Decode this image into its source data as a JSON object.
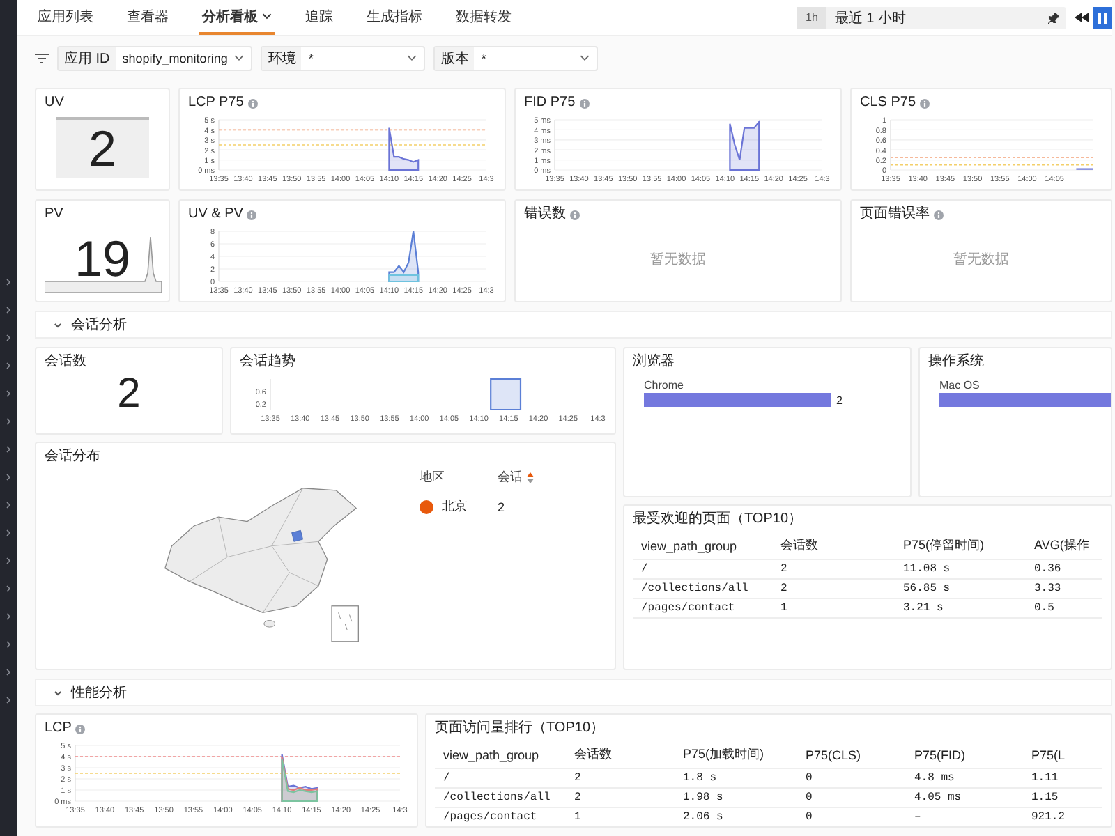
{
  "nav": {
    "tabs": [
      {
        "label": "应用列表",
        "selected": false,
        "dropdown": false
      },
      {
        "label": "查看器",
        "selected": false,
        "dropdown": false
      },
      {
        "label": "分析看板",
        "selected": true,
        "dropdown": true
      },
      {
        "label": "追踪",
        "selected": false,
        "dropdown": false
      },
      {
        "label": "生成指标",
        "selected": false,
        "dropdown": false
      },
      {
        "label": "数据转发",
        "selected": false,
        "dropdown": false
      }
    ],
    "time_range": {
      "badge": "1h",
      "label": "最近 1 小时"
    }
  },
  "filters": [
    {
      "label": "应用 ID",
      "value": "shopify_monitoring"
    },
    {
      "label": "环境",
      "value": "*"
    },
    {
      "label": "版本",
      "value": "*"
    }
  ],
  "overview_cards": [
    {
      "kind": "stat",
      "title": "UV",
      "help": false,
      "value": "2"
    },
    {
      "kind": "chart",
      "title": "LCP P75",
      "help": true,
      "chart_data": {
        "type": "area",
        "categories": [
          "13:35",
          null,
          null,
          null,
          null,
          "13:40",
          null,
          null,
          null,
          null,
          "13:45",
          null,
          null,
          null,
          null,
          "13:50",
          null,
          null,
          null,
          null,
          "13:55",
          null,
          null,
          null,
          null,
          "14:00",
          null,
          null,
          null,
          null,
          "14:05",
          null,
          null,
          null,
          null,
          "14:10",
          null,
          null,
          null,
          null,
          "14:15",
          null,
          null,
          null,
          null,
          "14:20",
          null,
          null,
          null,
          null,
          "14:25",
          null,
          null,
          null,
          null,
          "14:3"
        ],
        "ylim": [
          0,
          5
        ],
        "yticks": [
          {
            "value": 0,
            "label": "0 ms"
          },
          {
            "value": 1,
            "label": "1 s"
          },
          {
            "value": 2,
            "label": "2 s"
          },
          {
            "value": 3,
            "label": "3 s"
          },
          {
            "value": 4,
            "label": "4 s"
          },
          {
            "value": 5,
            "label": "5 s"
          }
        ],
        "grid": true,
        "ref_lines": [
          {
            "axis": "y",
            "value": 4,
            "color": "#f4a27a"
          },
          {
            "axis": "y",
            "value": 2.5,
            "color": "#f3cf6a"
          }
        ],
        "series": [
          {
            "color": "#6b74d6",
            "values": [
              null,
              null,
              null,
              null,
              null,
              null,
              null,
              null,
              null,
              null,
              null,
              null,
              null,
              null,
              null,
              null,
              null,
              null,
              null,
              null,
              null,
              null,
              null,
              null,
              null,
              null,
              null,
              null,
              null,
              null,
              null,
              null,
              null,
              null,
              null,
              4.2,
              1.3,
              1.3,
              1.1,
              1.0,
              0.8,
              1.0,
              null,
              null,
              null,
              null,
              null,
              null,
              null,
              null,
              null,
              null,
              null,
              null,
              null,
              null
            ]
          }
        ]
      }
    },
    {
      "kind": "chart",
      "title": "FID P75",
      "help": true,
      "chart_data": {
        "type": "area",
        "categories": [
          "13:35",
          null,
          null,
          null,
          null,
          "13:40",
          null,
          null,
          null,
          null,
          "13:45",
          null,
          null,
          null,
          null,
          "13:50",
          null,
          null,
          null,
          null,
          "13:55",
          null,
          null,
          null,
          null,
          "14:00",
          null,
          null,
          null,
          null,
          "14:05",
          null,
          null,
          null,
          null,
          "14:10",
          null,
          null,
          null,
          null,
          "14:15",
          null,
          null,
          null,
          null,
          "14:20",
          null,
          null,
          null,
          null,
          "14:25",
          null,
          null,
          null,
          null,
          "14:3"
        ],
        "grid": true,
        "ylim": [
          0,
          5
        ],
        "yticks": [
          {
            "value": 0,
            "label": "0 ms"
          },
          {
            "value": 1,
            "label": "1 ms"
          },
          {
            "value": 2,
            "label": "2 ms"
          },
          {
            "value": 3,
            "label": "3 ms"
          },
          {
            "value": 4,
            "label": "4 ms"
          },
          {
            "value": 5,
            "label": "5 ms"
          }
        ],
        "series": [
          {
            "color": "#6b74d6",
            "values": [
              null,
              null,
              null,
              null,
              null,
              null,
              null,
              null,
              null,
              null,
              null,
              null,
              null,
              null,
              null,
              null,
              null,
              null,
              null,
              null,
              null,
              null,
              null,
              null,
              null,
              null,
              null,
              null,
              null,
              null,
              null,
              null,
              null,
              null,
              null,
              null,
              4.6,
              2.5,
              1.0,
              4.2,
              4.2,
              4.2,
              4.8,
              null,
              null,
              null,
              null,
              null,
              null,
              null,
              null,
              null,
              null,
              null,
              null,
              null
            ]
          }
        ]
      }
    },
    {
      "kind": "chart",
      "title": "CLS P75",
      "help": true,
      "chart_data": {
        "type": "line",
        "categories": [
          "13:35",
          null,
          null,
          null,
          null,
          "13:40",
          null,
          null,
          null,
          null,
          "13:45",
          null,
          null,
          null,
          null,
          "13:50",
          null,
          null,
          null,
          null,
          "13:55",
          null,
          null,
          null,
          null,
          "14:00",
          null,
          null,
          null,
          null,
          "14:05",
          null,
          null,
          null,
          null,
          null,
          null,
          null
        ],
        "ylim": [
          0,
          1
        ],
        "yticks": [
          0,
          0.2,
          0.4,
          0.6,
          0.8,
          1
        ],
        "grid": true,
        "ref_lines": [
          {
            "axis": "y",
            "value": 0.25,
            "color": "#f4a27a"
          },
          {
            "axis": "y",
            "value": 0.1,
            "color": "#f3cf6a"
          }
        ],
        "series": [
          {
            "color": "#6b74d6",
            "values": [
              null,
              null,
              null,
              null,
              null,
              null,
              null,
              null,
              null,
              null,
              null,
              null,
              null,
              null,
              null,
              null,
              null,
              null,
              null,
              null,
              null,
              null,
              null,
              null,
              null,
              null,
              null,
              null,
              null,
              null,
              null,
              null,
              null,
              null,
              0.02,
              0.02,
              0.02,
              0.02
            ]
          }
        ]
      }
    },
    {
      "kind": "sparkline_stat",
      "title": "PV",
      "help": false,
      "value": "19"
    },
    {
      "kind": "chart",
      "title": "UV & PV",
      "help": true,
      "chart_data": {
        "type": "area",
        "categories": [
          "13:35",
          null,
          null,
          null,
          null,
          "13:40",
          null,
          null,
          null,
          null,
          "13:45",
          null,
          null,
          null,
          null,
          "13:50",
          null,
          null,
          null,
          null,
          "13:55",
          null,
          null,
          null,
          null,
          "14:00",
          null,
          null,
          null,
          null,
          "14:05",
          null,
          null,
          null,
          null,
          "14:10",
          null,
          null,
          null,
          null,
          "14:15",
          null,
          null,
          null,
          null,
          "14:20",
          null,
          null,
          null,
          null,
          "14:25",
          null,
          null,
          null,
          null,
          "14:3"
        ],
        "grid": true,
        "ylim": [
          0,
          8
        ],
        "yticks": [
          0,
          2,
          4,
          6,
          8
        ],
        "series": [
          {
            "color": "#5b7fd6",
            "values": [
              null,
              null,
              null,
              null,
              null,
              null,
              null,
              null,
              null,
              null,
              null,
              null,
              null,
              null,
              null,
              null,
              null,
              null,
              null,
              null,
              null,
              null,
              null,
              null,
              null,
              null,
              null,
              null,
              null,
              null,
              null,
              null,
              null,
              null,
              null,
              1.5,
              1.5,
              2.5,
              1.5,
              3,
              8,
              1.5,
              null,
              null,
              null,
              null,
              null,
              null,
              null,
              null,
              null,
              null,
              null,
              null,
              null,
              null
            ]
          },
          {
            "color": "#6fc3df",
            "values": [
              null,
              null,
              null,
              null,
              null,
              null,
              null,
              null,
              null,
              null,
              null,
              null,
              null,
              null,
              null,
              null,
              null,
              null,
              null,
              null,
              null,
              null,
              null,
              null,
              null,
              null,
              null,
              null,
              null,
              null,
              null,
              null,
              null,
              null,
              null,
              1,
              1,
              1,
              1,
              1,
              1,
              1,
              null,
              null,
              null,
              null,
              null,
              null,
              null,
              null,
              null,
              null,
              null,
              null,
              null,
              null
            ]
          }
        ]
      }
    },
    {
      "kind": "empty",
      "title": "错误数",
      "help": true,
      "empty_text": "暂无数据"
    },
    {
      "kind": "empty",
      "title": "页面错误率",
      "help": true,
      "empty_text": "暂无数据"
    }
  ],
  "session_section": {
    "title": "会话分析",
    "expanded": true,
    "count_card": {
      "title": "会话数",
      "value": "2"
    },
    "trend_card": {
      "title": "会话趋势",
      "chart_data": {
        "type": "area",
        "categories": [
          "13:35",
          null,
          null,
          null,
          null,
          "13:40",
          null,
          null,
          null,
          null,
          "13:45",
          null,
          null,
          null,
          null,
          "13:50",
          null,
          null,
          null,
          null,
          "13:55",
          null,
          null,
          null,
          null,
          "14:00",
          null,
          null,
          null,
          null,
          "14:05",
          null,
          null,
          null,
          null,
          "14:10",
          null,
          null,
          null,
          null,
          "14:15",
          null,
          null,
          null,
          null,
          "14:20",
          null,
          null,
          null,
          null,
          "14:25",
          null,
          null,
          null,
          null,
          "14:3"
        ],
        "ylim": [
          0,
          1
        ],
        "yticks": [
          0.2,
          0.6
        ],
        "series": [
          {
            "color": "#5b7fd6",
            "values": [
              null,
              null,
              null,
              null,
              null,
              null,
              null,
              null,
              null,
              null,
              null,
              null,
              null,
              null,
              null,
              null,
              null,
              null,
              null,
              null,
              null,
              null,
              null,
              null,
              null,
              null,
              null,
              null,
              null,
              null,
              null,
              null,
              null,
              null,
              null,
              null,
              null,
              1,
              1,
              1,
              1,
              1,
              1,
              null,
              null,
              null,
              null,
              null,
              null,
              null,
              null,
              null,
              null,
              null,
              null,
              null
            ]
          }
        ]
      }
    },
    "browser_card": {
      "title": "浏览器",
      "chart_data": {
        "type": "bar",
        "orientation": "horizontal",
        "categories": [
          "Chrome"
        ],
        "data_labels": true,
        "series": [
          {
            "color": "#7478de",
            "values": [
              2
            ]
          }
        ]
      }
    },
    "os_card": {
      "title": "操作系统",
      "bar_label": "Mac OS"
    },
    "map_card": {
      "title": "会话分布",
      "columns": [
        "地区",
        "会话"
      ],
      "regions": [
        {
          "name": "北京",
          "sessions": "2",
          "color": "#e8590c"
        }
      ]
    },
    "top_pages": {
      "title": "最受欢迎的页面（TOP10）",
      "columns": [
        "view_path_group",
        "会话数",
        "P75(停留时间)",
        "AVG(操作"
      ],
      "rows": [
        [
          "/",
          "2",
          "11.08 s",
          "0.36"
        ],
        [
          "/collections/all",
          "2",
          "56.85 s",
          "3.33"
        ],
        [
          "/pages/contact",
          "1",
          "3.21 s",
          "0.5"
        ]
      ]
    }
  },
  "performance_section": {
    "title": "性能分析",
    "expanded": true,
    "lcp_card": {
      "title": "LCP",
      "help": true,
      "chart_data": {
        "type": "area",
        "categories": [
          "13:35",
          null,
          null,
          null,
          null,
          "13:40",
          null,
          null,
          null,
          null,
          "13:45",
          null,
          null,
          null,
          null,
          "13:50",
          null,
          null,
          null,
          null,
          "13:55",
          null,
          null,
          null,
          null,
          "14:00",
          null,
          null,
          null,
          null,
          "14:05",
          null,
          null,
          null,
          null,
          "14:10",
          null,
          null,
          null,
          null,
          "14:15",
          null,
          null,
          null,
          null,
          "14:20",
          null,
          null,
          null,
          null,
          "14:25",
          null,
          null,
          null,
          null,
          "14:3"
        ],
        "ylim": [
          0,
          5
        ],
        "yticks": [
          {
            "value": 0,
            "label": "0 ms"
          },
          {
            "value": 1,
            "label": "1 s"
          },
          {
            "value": 2,
            "label": "2 s"
          },
          {
            "value": 3,
            "label": "3 s"
          },
          {
            "value": 4,
            "label": "4 s"
          },
          {
            "value": 5,
            "label": "5 s"
          }
        ],
        "grid": true,
        "ref_lines": [
          {
            "axis": "y",
            "value": 4,
            "color": "#f08a8a"
          },
          {
            "axis": "y",
            "value": 2.5,
            "color": "#f3cf6a"
          }
        ],
        "series": [
          {
            "color": "#6b74d6",
            "values": [
              null,
              null,
              null,
              null,
              null,
              null,
              null,
              null,
              null,
              null,
              null,
              null,
              null,
              null,
              null,
              null,
              null,
              null,
              null,
              null,
              null,
              null,
              null,
              null,
              null,
              null,
              null,
              null,
              null,
              null,
              null,
              null,
              null,
              null,
              null,
              4.2,
              1.3,
              1.4,
              1.2,
              1.3,
              1.1,
              1.2,
              null,
              null,
              null,
              null,
              null,
              null,
              null,
              null,
              null,
              null,
              null,
              null,
              null,
              null
            ]
          },
          {
            "color": "#e07b7b",
            "values": [
              null,
              null,
              null,
              null,
              null,
              null,
              null,
              null,
              null,
              null,
              null,
              null,
              null,
              null,
              null,
              null,
              null,
              null,
              null,
              null,
              null,
              null,
              null,
              null,
              null,
              null,
              null,
              null,
              null,
              null,
              null,
              null,
              null,
              null,
              null,
              4.0,
              1.1,
              1.0,
              1.2,
              1.0,
              1.0,
              1.1,
              null,
              null,
              null,
              null,
              null,
              null,
              null,
              null,
              null,
              null,
              null,
              null,
              null,
              null
            ]
          },
          {
            "color": "#7cc4a0",
            "values": [
              null,
              null,
              null,
              null,
              null,
              null,
              null,
              null,
              null,
              null,
              null,
              null,
              null,
              null,
              null,
              null,
              null,
              null,
              null,
              null,
              null,
              null,
              null,
              null,
              null,
              null,
              null,
              null,
              null,
              null,
              null,
              null,
              null,
              null,
              null,
              3.8,
              0.9,
              0.8,
              1.0,
              0.9,
              0.8,
              0.9,
              null,
              null,
              null,
              null,
              null,
              null,
              null,
              null,
              null,
              null,
              null,
              null,
              null,
              null
            ]
          }
        ]
      }
    },
    "top_pages": {
      "title": "页面访问量排行（TOP10）",
      "columns": [
        "view_path_group",
        "会话数",
        "P75(加载时间)",
        "P75(CLS)",
        "P75(FID)",
        "P75(L"
      ],
      "rows": [
        [
          "/",
          "2",
          "1.8 s",
          "0",
          "4.8 ms",
          "1.11"
        ],
        [
          "/collections/all",
          "2",
          "1.98 s",
          "0",
          "4.05 ms",
          "1.15"
        ],
        [
          "/pages/contact",
          "1",
          "2.06 s",
          "0",
          "–",
          "921.2"
        ]
      ]
    }
  }
}
